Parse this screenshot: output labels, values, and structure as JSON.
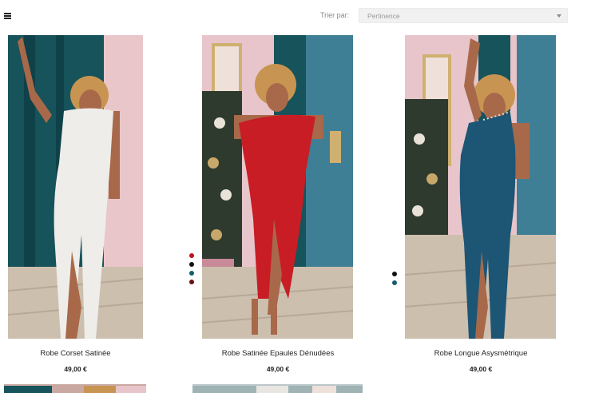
{
  "toolbar": {
    "view_icon": "list-icon",
    "sort_label": "Trier par:",
    "sort_value": "Pertinence"
  },
  "products": [
    {
      "name": "Robe Corset Satinée",
      "price": "49,00 €",
      "dress_color": "#ecebe9",
      "colors": []
    },
    {
      "name": "Robe Satinée Epaules Dénudées",
      "price": "49,00 €",
      "dress_color": "#c81d25",
      "colors": [
        "#c0121b",
        "#111111",
        "#145d70",
        "#6a0f17"
      ]
    },
    {
      "name": "Robe Longue Asysmétrique",
      "price": "49,00 €",
      "dress_color": "#1d5575",
      "colors": [
        "#111111",
        "#145d70"
      ]
    }
  ]
}
